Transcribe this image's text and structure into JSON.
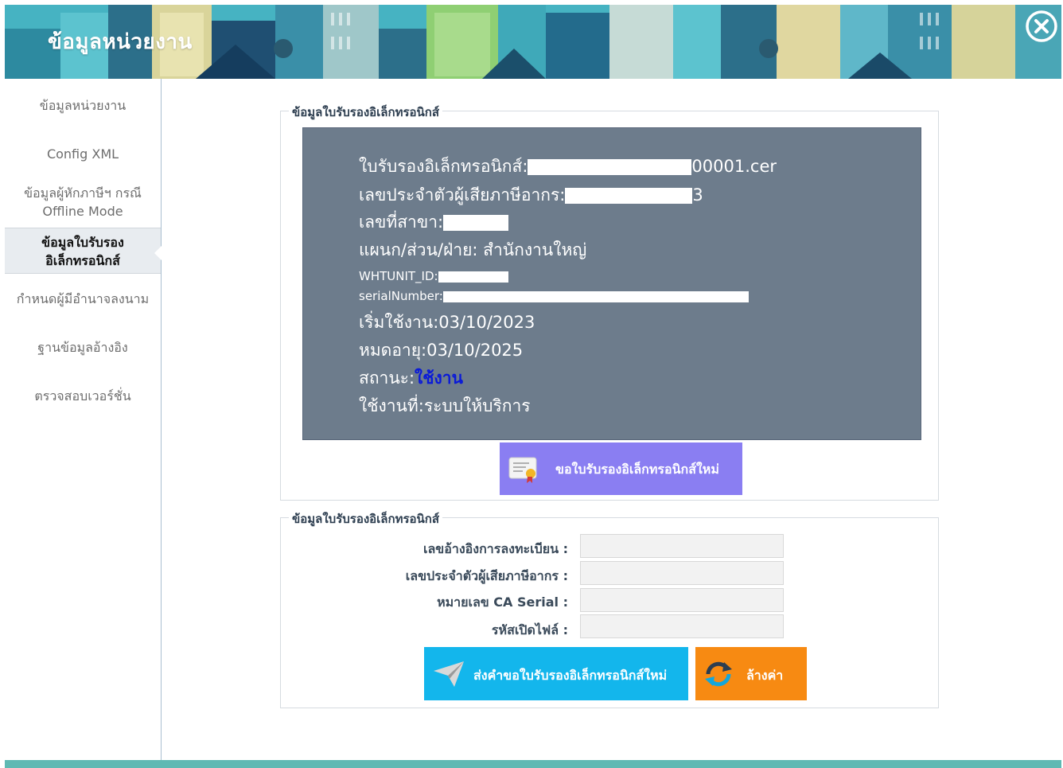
{
  "window": {
    "title": "ข้อมูลหน่วยงาน",
    "close_icon": "close-circle-icon"
  },
  "sidebar": {
    "items": [
      {
        "label": "ข้อมูลหน่วยงาน"
      },
      {
        "label": "Config XML"
      },
      {
        "label_line1": "ข้อมูลผู้หักภาษีฯ กรณี",
        "label_line2": "Offline Mode"
      },
      {
        "label_line1": "ข้อมูลใบรับรอง",
        "label_line2": "อิเล็กทรอนิกส์",
        "active": true
      },
      {
        "label": "กำหนดผู้มีอำนาจลงนาม"
      },
      {
        "label": "ฐานข้อมูลอ้างอิง"
      },
      {
        "label": "ตรวจสอบเวอร์ชั่น"
      }
    ]
  },
  "cert_panel": {
    "legend": "ข้อมูลใบรับรองอิเล็กทรอนิกส์",
    "cert_file_label": "ใบรับรองอิเล็กทรอนิกส์:",
    "cert_file_suffix": "00001.cer",
    "tax_id_label": "เลขประจำตัวผู้เสียภาษีอากร:",
    "tax_id_suffix": "3",
    "branch_label": "เลขที่สาขา:",
    "department": "แผนก/ส่วน/ฝ่าย: สำนักงานใหญ่",
    "whtunit_label": "WHTUNIT_ID:",
    "serial_label": "serialNumber:",
    "start_label": "เริ่มใช้งาน:",
    "start_date": "03/10/2023",
    "expire_label": "หมดอายุ:",
    "expire_date": "03/10/2025",
    "status_label": "สถานะ:",
    "status_value": "ใช้งาน",
    "usage": "ใช้งานที่:ระบบให้บริการ",
    "new_cert_button": "ขอใบรับรองอิเล็กทรอนิกส์ใหม่",
    "new_cert_icon": "certificate-icon"
  },
  "request_panel": {
    "legend": "ข้อมูลใบรับรองอิเล็กทรอนิกส์",
    "fields": [
      {
        "label": "เลขอ้างอิงการลงทะเบียน :",
        "value": ""
      },
      {
        "label": "เลขประจำตัวผู้เสียภาษีอากร :",
        "value": ""
      },
      {
        "label": "หมายเลข CA Serial :",
        "value": ""
      },
      {
        "label": "รหัสเปิดไฟล์ :",
        "value": ""
      }
    ],
    "send_button": "ส่งคำขอใบรับรองอิเล็กทรอนิกส์ใหม่",
    "send_icon": "paper-plane-icon",
    "clear_button": "ล้างค่า",
    "clear_icon": "refresh-icon"
  },
  "colors": {
    "header": "#3fa9b9",
    "cert_box": "#6d7c8c",
    "new_cert_button": "#8a7ef2",
    "send_button": "#13b6ec",
    "clear_button": "#f78a12",
    "status_active": "#0a1ad8"
  }
}
